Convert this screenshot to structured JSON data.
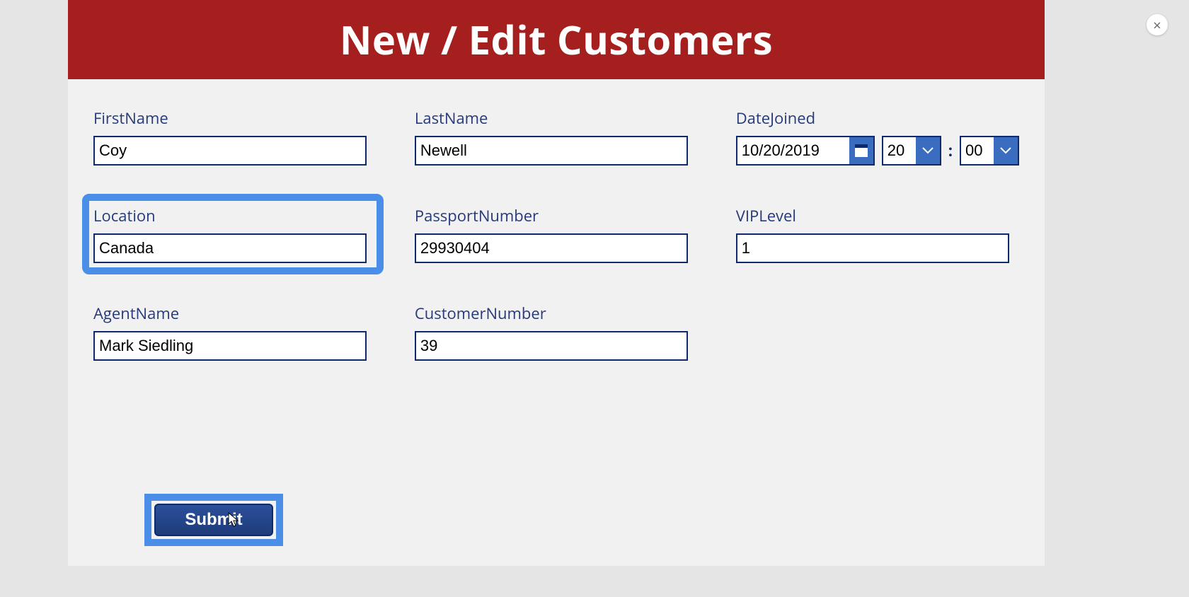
{
  "header": {
    "title": "New / Edit Customers"
  },
  "labels": {
    "firstName": "FirstName",
    "lastName": "LastName",
    "dateJoined": "DateJoined",
    "location": "Location",
    "passportNumber": "PassportNumber",
    "vipLevel": "VIPLevel",
    "agentName": "AgentName",
    "customerNumber": "CustomerNumber"
  },
  "values": {
    "firstName": "Coy",
    "lastName": "Newell",
    "date": "10/20/2019",
    "hour": "20",
    "minute": "00",
    "location": "Canada",
    "passportNumber": "29930404",
    "vipLevel": "1",
    "agentName": "Mark Siedling",
    "customerNumber": "39"
  },
  "buttons": {
    "submit": "Submit",
    "close": "×",
    "timeSeparator": ":"
  },
  "colors": {
    "headerBg": "#a61f1f",
    "labelText": "#273a7a",
    "inputBorder": "#0d2a6a",
    "highlight": "#4a8ee8",
    "accent": "#3a6cc0"
  }
}
